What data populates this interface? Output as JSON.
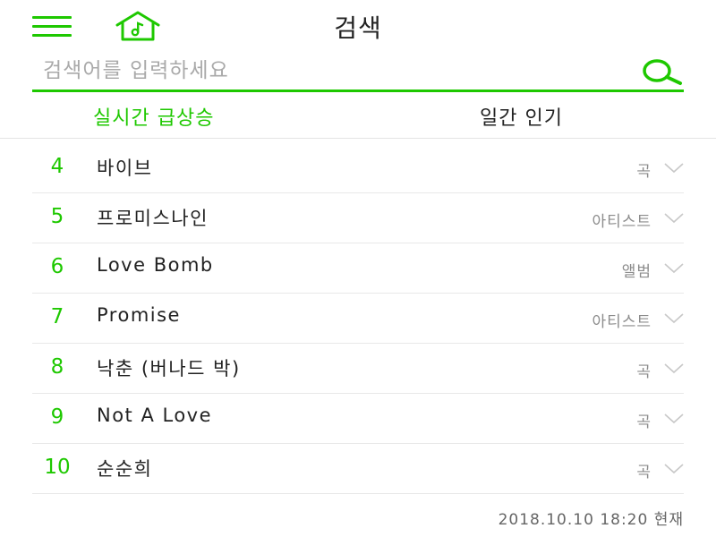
{
  "colors": {
    "accent": "#1ec800",
    "text": "#222222",
    "muted": "#8c8c8c"
  },
  "header": {
    "menu_icon": "hamburger-menu-icon",
    "home_icon": "music-home-icon",
    "title": "검색"
  },
  "search": {
    "placeholder": "검색어를 입력하세요",
    "value": "",
    "icon": "search-icon"
  },
  "tabs": [
    {
      "label": "실시간 급상승",
      "active": true
    },
    {
      "label": "일간 인기",
      "active": false
    }
  ],
  "items": [
    {
      "rank": "4",
      "keyword": "바이브",
      "type": "곡"
    },
    {
      "rank": "5",
      "keyword": "프로미스나인",
      "type": "아티스트"
    },
    {
      "rank": "6",
      "keyword": "Love Bomb",
      "type": "앨범"
    },
    {
      "rank": "7",
      "keyword": "Promise",
      "type": "아티스트"
    },
    {
      "rank": "8",
      "keyword": "낙춘 (버나드 박)",
      "type": "곡"
    },
    {
      "rank": "9",
      "keyword": "Not A Love",
      "type": "곡"
    },
    {
      "rank": "10",
      "keyword": "순순희",
      "type": "곡"
    }
  ],
  "timestamp": "2018.10.10 18:20 현재"
}
